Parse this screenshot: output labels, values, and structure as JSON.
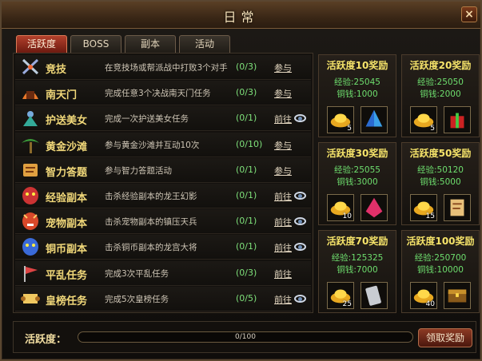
{
  "window": {
    "title": "日常",
    "close_label": "×"
  },
  "tabs": [
    {
      "label": "活跃度",
      "active": true
    },
    {
      "label": "BOSS",
      "active": false
    },
    {
      "label": "副本",
      "active": false
    },
    {
      "label": "活动",
      "active": false
    }
  ],
  "tasks": [
    {
      "name": "竞技",
      "desc": "在竞技场或帮派战中打败3个对手",
      "progress": "(0/3)",
      "action": "参与",
      "icon": "crossed-swords-icon",
      "show_eye": false
    },
    {
      "name": "南天门",
      "desc": "完成任意3个决战南天门任务",
      "progress": "(0/3)",
      "action": "参与",
      "icon": "gate-icon",
      "show_eye": false
    },
    {
      "name": "护送美女",
      "desc": "完成一次护送美女任务",
      "progress": "(0/1)",
      "action": "前往",
      "icon": "fairy-icon",
      "show_eye": true
    },
    {
      "name": "黄金沙滩",
      "desc": "参与黄金沙滩并互动10次",
      "progress": "(0/10)",
      "action": "参与",
      "icon": "palm-tree-icon",
      "show_eye": false
    },
    {
      "name": "智力答题",
      "desc": "参与智力答题活动",
      "progress": "(0/1)",
      "action": "参与",
      "icon": "scroll-quiz-icon",
      "show_eye": false
    },
    {
      "name": "经验副本",
      "desc": "击杀经验副本的龙王幻影",
      "progress": "(0/1)",
      "action": "前往",
      "icon": "red-mask-icon",
      "show_eye": true
    },
    {
      "name": "宠物副本",
      "desc": "击杀宠物副本的镇压天兵",
      "progress": "(0/1)",
      "action": "前往",
      "icon": "demon-mask-icon",
      "show_eye": true
    },
    {
      "name": "铜币副本",
      "desc": "击杀铜币副本的龙宫大将",
      "progress": "(0/1)",
      "action": "前往",
      "icon": "blue-mask-icon",
      "show_eye": true
    },
    {
      "name": "平乱任务",
      "desc": "完成3次平乱任务",
      "progress": "(0/3)",
      "action": "前往",
      "icon": "flag-icon",
      "show_eye": false
    },
    {
      "name": "皇榜任务",
      "desc": "完成5次皇榜任务",
      "progress": "(0/5)",
      "action": "前往",
      "icon": "imperial-scroll-icon",
      "show_eye": true
    }
  ],
  "rewards": [
    {
      "title": "活跃度10奖励",
      "exp": "经验:25045",
      "coin": "铜钱:1000",
      "items": [
        {
          "icon": "gold-ingot-icon",
          "count": "5"
        },
        {
          "icon": "blue-crystal-icon",
          "count": ""
        }
      ]
    },
    {
      "title": "活跃度20奖励",
      "exp": "经验:25050",
      "coin": "铜钱:2000",
      "items": [
        {
          "icon": "gold-ingot-icon",
          "count": "5"
        },
        {
          "icon": "red-gift-icon",
          "count": ""
        }
      ]
    },
    {
      "title": "活跃度30奖励",
      "exp": "经验:25055",
      "coin": "铜钱:3000",
      "items": [
        {
          "icon": "gold-ingot-icon",
          "count": "10"
        },
        {
          "icon": "red-crystal-icon",
          "count": ""
        }
      ]
    },
    {
      "title": "活跃度50奖励",
      "exp": "经验:50120",
      "coin": "铜钱:5000",
      "items": [
        {
          "icon": "gold-ingot-icon",
          "count": "15"
        },
        {
          "icon": "scroll-icon",
          "count": ""
        }
      ]
    },
    {
      "title": "活跃度70奖励",
      "exp": "经验:125325",
      "coin": "铜钱:7000",
      "items": [
        {
          "icon": "gold-ingot-icon",
          "count": "25"
        },
        {
          "icon": "silver-talisman-icon",
          "count": ""
        }
      ]
    },
    {
      "title": "活跃度100奖励",
      "exp": "经验:250700",
      "coin": "铜钱:10000",
      "items": [
        {
          "icon": "gold-ingot-icon",
          "count": "40"
        },
        {
          "icon": "treasure-chest-icon",
          "count": ""
        }
      ]
    }
  ],
  "footer": {
    "label": "活跃度：",
    "progress_text": "0/100",
    "progress_fraction": 0,
    "claim_label": "领取奖励"
  },
  "colors": {
    "accent_gold": "#f6e46a",
    "progress_green": "#7ee07a",
    "tab_active": "#b2402c"
  }
}
